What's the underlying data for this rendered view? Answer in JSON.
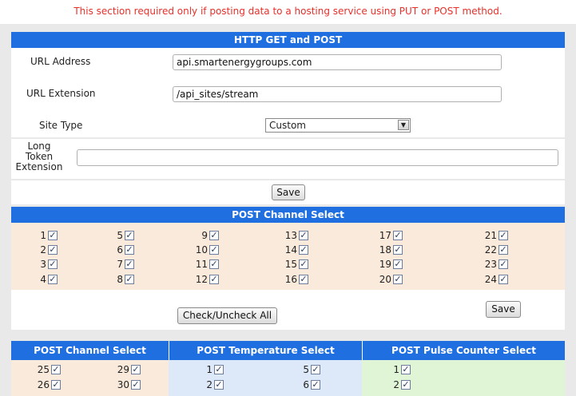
{
  "notice": "This section required only if posting data to a hosting service using PUT or POST method.",
  "http": {
    "title": "HTTP GET and POST",
    "url_address_label": "URL Address",
    "url_address_value": "api.smartenergygroups.com",
    "url_extension_label": "URL Extension",
    "url_extension_value": "/api_sites/stream",
    "site_type_label": "Site Type",
    "site_type_value": "Custom",
    "long_token_label_1": "Long",
    "long_token_label_2": "Token",
    "long_token_label_3": "Extension",
    "long_token_value": "",
    "save_label": "Save"
  },
  "post_channel": {
    "title": "POST Channel Select",
    "channels": [
      "1",
      "2",
      "3",
      "4",
      "5",
      "6",
      "7",
      "8",
      "9",
      "10",
      "11",
      "12",
      "13",
      "14",
      "15",
      "16",
      "17",
      "18",
      "19",
      "20",
      "21",
      "22",
      "23",
      "24"
    ],
    "check_all_label": "Check/Uncheck All",
    "save_label": "Save"
  },
  "bottom": {
    "channel_title": "POST Channel Select",
    "channel_left": [
      "25",
      "26"
    ],
    "channel_right": [
      "29",
      "30"
    ],
    "temp_title": "POST Temperature Select",
    "temp_left": [
      "1",
      "2"
    ],
    "temp_right": [
      "5",
      "6"
    ],
    "pulse_title": "POST Pulse Counter Select",
    "pulse_left": [
      "1",
      "2"
    ]
  },
  "colors": {
    "header_bar": "#1f6fe0",
    "notice_text": "#e8302a",
    "peach": "#faeadb",
    "light_blue": "#dde9f8",
    "light_green": "#dff5d6"
  }
}
